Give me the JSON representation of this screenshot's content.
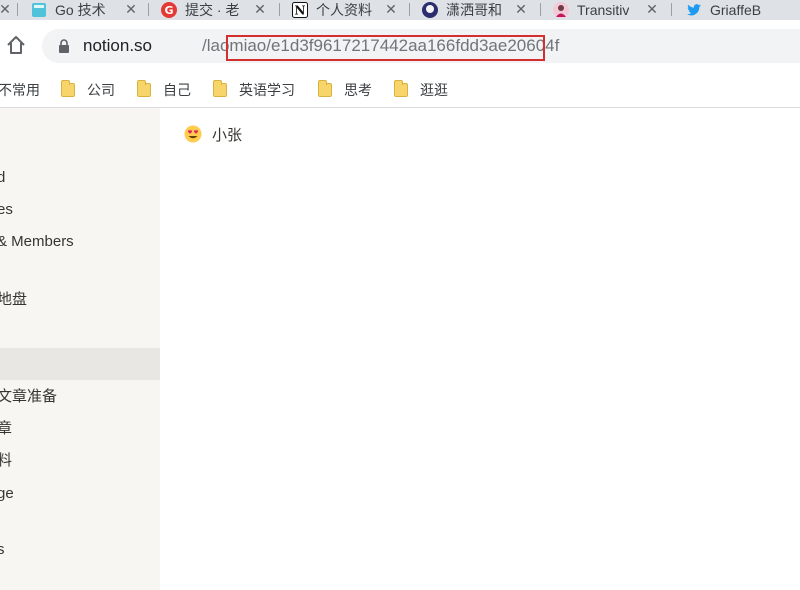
{
  "tabs": [
    {
      "label": "",
      "icon": "tab-partial-icon"
    },
    {
      "label": "Go 技术",
      "icon": "bookmark-page-icon"
    },
    {
      "label": "提交 · 老",
      "icon": "red-g-icon"
    },
    {
      "label": "个人资料",
      "icon": "notion-icon"
    },
    {
      "label": "潇洒哥和",
      "icon": "avatar-icon"
    },
    {
      "label": "Transitiv",
      "icon": "avatar-icon"
    },
    {
      "label": "GriaffeB",
      "icon": "twitter-icon"
    }
  ],
  "address": {
    "host": "notion.so",
    "path_visible": "/laomiao/e1d3f9617217442aa166fdd3ae20604f",
    "highlighted": "/e1d3f9617217442aa166fdd3ae20604f",
    "highlight_color": "#d32f2f"
  },
  "bookmarks": [
    "不常用",
    "公司",
    "自己",
    "英语学习",
    "思考",
    "逛逛"
  ],
  "sidebar": {
    "items": [
      "d",
      "es",
      "& Members",
      "地盘",
      "",
      "文章准备",
      "章",
      "料",
      "ge",
      "s"
    ],
    "background": "#f7f6f3",
    "active_background": "#e8e7e4"
  },
  "main": {
    "page_title": "小张",
    "page_icon": "heart-eyes-emoji-icon"
  }
}
